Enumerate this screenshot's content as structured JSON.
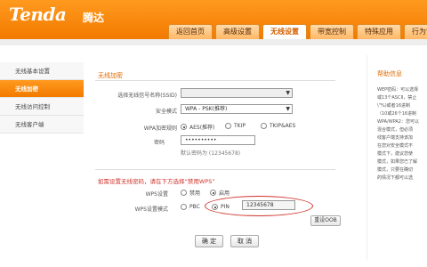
{
  "brand": {
    "logo": "Tenda",
    "name_cn": "腾达"
  },
  "tabs": [
    {
      "label": "返回首页"
    },
    {
      "label": "高级设置"
    },
    {
      "label": "无线设置"
    },
    {
      "label": "带宽控制"
    },
    {
      "label": "特殊应用"
    },
    {
      "label": "行为管理"
    }
  ],
  "sidebar": {
    "items": [
      {
        "label": "无线基本设置"
      },
      {
        "label": "无线加密"
      },
      {
        "label": "无线访问控制"
      },
      {
        "label": "无线客户端"
      }
    ]
  },
  "main": {
    "section_title": "无线加密",
    "ssid_label": "选择无线信号名称(SSID)",
    "ssid_value": "",
    "security_label": "安全模式",
    "security_value": "WPA - PSK(推荐)",
    "algo_label": "WPA加密规则",
    "algo_options": [
      "AES(推荐)",
      "TKIP",
      "TKIP&AES"
    ],
    "password_label": "密码",
    "password_value": "••••••••••",
    "default_password": "默认密码为 (12345678)",
    "wps_warning": "如需设置无线密码，请在下方选择“禁用WPS”",
    "wps_label": "WPS设置",
    "wps_options": [
      "禁用",
      "启用"
    ],
    "wps_mode_label": "WPS设置模式",
    "wps_mode_options": [
      "PBC",
      "PIN"
    ],
    "pin_value": "12345678",
    "reset_oob": "重设OOB",
    "confirm": "确 定",
    "cancel": "取 消"
  },
  "help": {
    "title": "帮助信息",
    "lines": [
      "WEP密码：可以选择",
      "或13个ASCII，禁止",
      "\\\"%)或者16进制",
      "（10或26个16进制",
      "WPA/WPA2：您可以",
      "混合模式，但必须",
      "线客户端支持该加",
      "在您对安全模式不",
      "模式下，建议您使",
      "模式，如果您已了解",
      "模式，只要在确切",
      "的情况下都可以选"
    ]
  }
}
